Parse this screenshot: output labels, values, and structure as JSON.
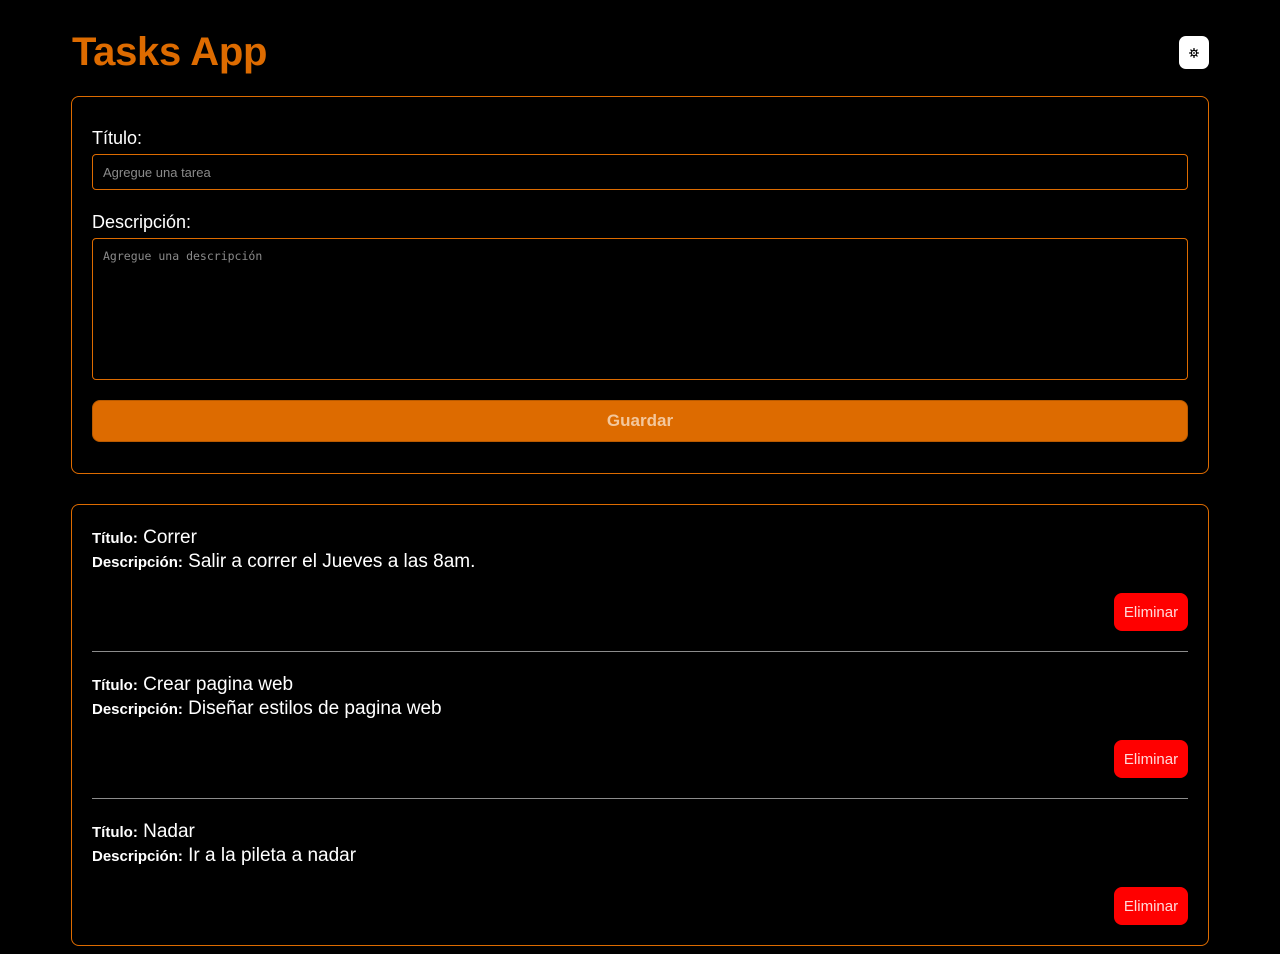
{
  "header": {
    "title": "Tasks App",
    "theme_icon": "gear-icon"
  },
  "form": {
    "title_label": "Título:",
    "title_placeholder": "Agregue una tarea",
    "title_value": "",
    "description_label": "Descripción:",
    "description_placeholder": "Agregue una descripción",
    "description_value": "",
    "save_label": "Guardar"
  },
  "tasks": {
    "title_prefix": "Título:",
    "description_prefix": "Descripción:",
    "delete_label": "Eliminar",
    "items": [
      {
        "title": "Correr",
        "description": "Salir a correr el Jueves a las 8am."
      },
      {
        "title": "Crear pagina web",
        "description": "Diseñar estilos de pagina web"
      },
      {
        "title": "Nadar",
        "description": "Ir a la pileta a nadar"
      }
    ]
  },
  "colors": {
    "accent": "#dd6b00",
    "danger": "#ff0000",
    "background": "#000000"
  }
}
